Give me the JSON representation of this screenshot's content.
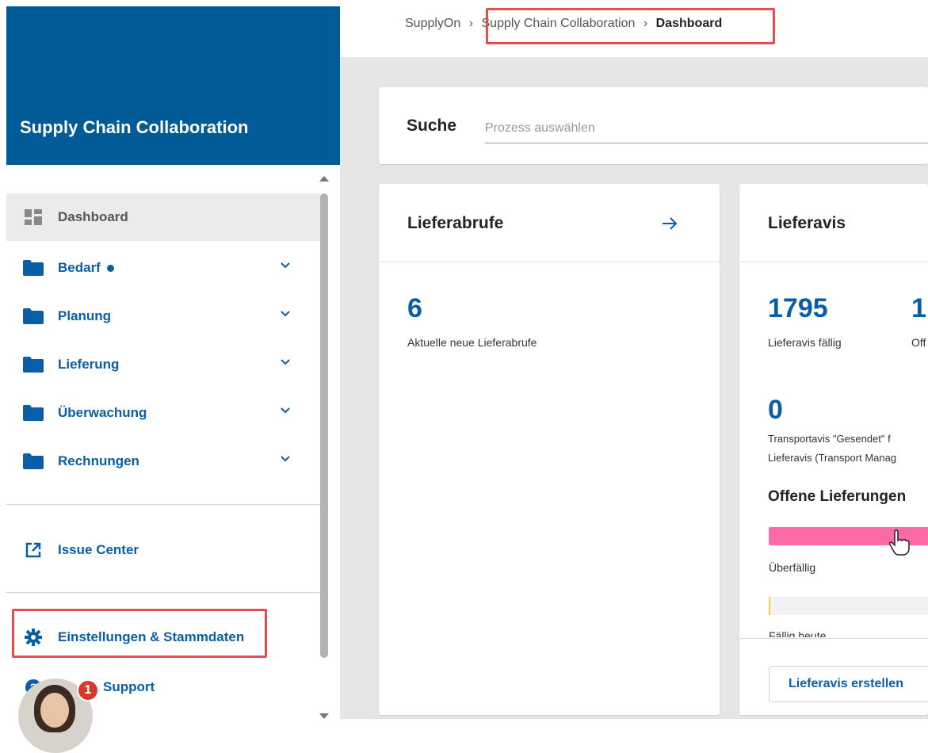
{
  "sidebar": {
    "title": "Supply Chain Collaboration",
    "items": [
      {
        "label": "Dashboard",
        "icon": "dashboard-icon"
      },
      {
        "label": "Bedarf",
        "icon": "folder-icon"
      },
      {
        "label": "Planung",
        "icon": "folder-icon"
      },
      {
        "label": "Lieferung",
        "icon": "folder-icon"
      },
      {
        "label": "Überwachung",
        "icon": "folder-icon"
      },
      {
        "label": "Rechnungen",
        "icon": "folder-icon"
      }
    ],
    "issue_center": "Issue Center",
    "settings": "Einstellungen & Stammdaten",
    "support": "& Support",
    "badge_count": "1"
  },
  "breadcrumb": {
    "root": "SupplyOn",
    "section": "Supply Chain Collaboration",
    "current": "Dashboard"
  },
  "search": {
    "label": "Suche",
    "placeholder": "Prozess auswählen"
  },
  "cards": {
    "lieferabrufe": {
      "title": "Lieferabrufe",
      "count": "6",
      "count_label": "Aktuelle neue Lieferabrufe"
    },
    "lieferavis": {
      "title": "Lieferavis",
      "count1": "1795",
      "count1_label": "Lieferavis fällig",
      "count2": "1",
      "count2_label": "Off",
      "count3": "0",
      "count3_label_line1": "Transportavis \"Gesendet\" f",
      "count3_label_line2": "Lieferavis (Transport Manag",
      "section_title": "Offene Lieferungen",
      "overdue_label": "Überfällig",
      "due_today_label": "Fällig heute",
      "button_label": "Lieferavis erstellen"
    }
  },
  "colors": {
    "brand": "#005b96",
    "accent": "#0a5ea8",
    "overdue": "#ff69a6",
    "highlight": "#e05050"
  }
}
